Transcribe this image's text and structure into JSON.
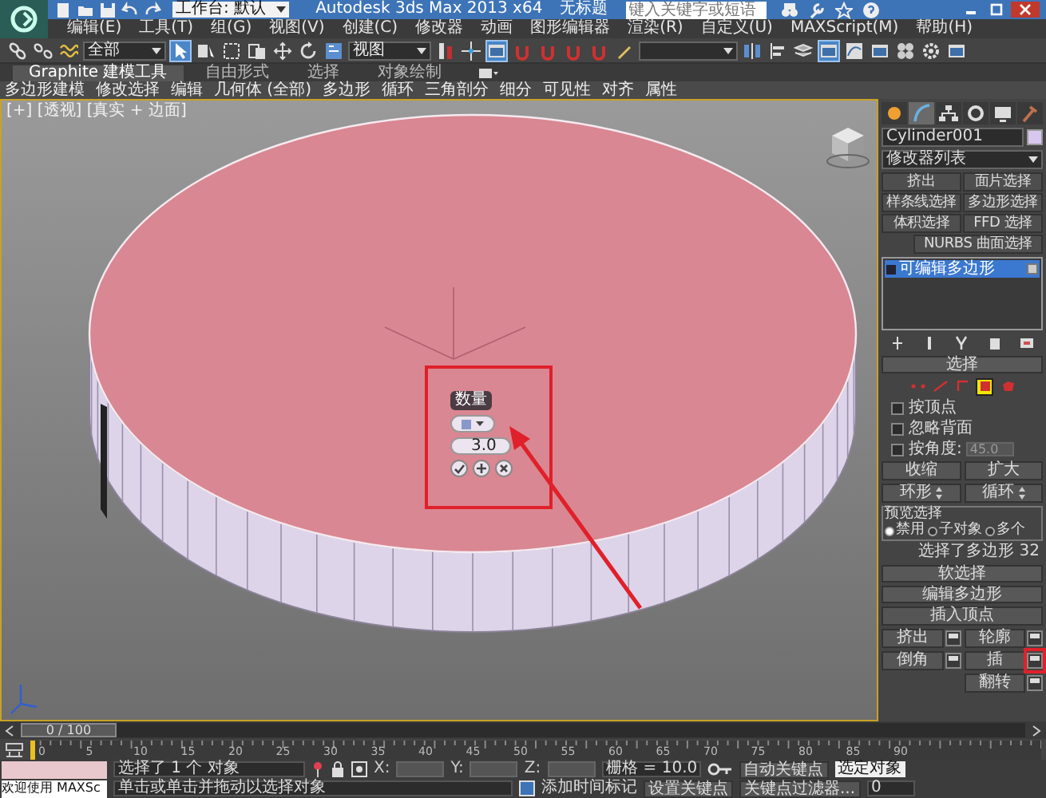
{
  "title_bar": {
    "workspace": "工作台: 默认",
    "app_title": "Autodesk 3ds Max  2013 x64",
    "document": "无标题",
    "search_placeholder": "键入关键字或短语"
  },
  "menu_bar": [
    "编辑(E)",
    "工具(T)",
    "组(G)",
    "视图(V)",
    "创建(C)",
    "修改器",
    "动画",
    "图形编辑器",
    "渲染(R)",
    "自定义(U)",
    "MAXScript(M)",
    "帮助(H)"
  ],
  "main_toolbar": {
    "selection_filter": "全部",
    "reference_coordinate": "视图",
    "tools": [
      {
        "selected": false
      },
      {
        "selected": false
      },
      {
        "selected": false
      },
      {
        "selected": true
      },
      {
        "selected": false
      },
      {
        "selected": false
      },
      {
        "selected": false
      },
      {
        "selected": false
      },
      {
        "selected": false
      },
      {
        "selected": false
      },
      {
        "selected": false
      },
      {
        "selected": false
      },
      {
        "selected": true
      },
      {
        "selected": false
      },
      {
        "selected": false
      },
      {
        "selected": false
      },
      {
        "selected": false
      },
      {
        "selected": false
      },
      {
        "selected": false
      },
      {
        "selected": false
      },
      {
        "selected": false
      },
      {
        "selected": true
      },
      {
        "selected": false
      },
      {
        "selected": false
      },
      {
        "selected": false
      },
      {
        "selected": false
      },
      {
        "selected": false
      }
    ]
  },
  "ribbon": {
    "tabs": [
      {
        "label": "Graphite 建模工具",
        "selected": true
      },
      {
        "label": "自由形式",
        "selected": false
      },
      {
        "label": "选择",
        "selected": false
      },
      {
        "label": "对象绘制",
        "selected": false
      }
    ],
    "panels": [
      "多边形建模",
      "修改选择",
      "编辑",
      "几何体 (全部)",
      "多边形",
      "循环",
      "三角剖分",
      "细分",
      "可见性",
      "对齐",
      "属性"
    ]
  },
  "viewport": {
    "label": "[+] [透视] [真实 + 边面]",
    "caddy": {
      "label": "数量",
      "value": "3.0"
    }
  },
  "command_panel": {
    "tabs": [
      {
        "selected": false
      },
      {
        "selected": true
      },
      {
        "selected": false
      },
      {
        "selected": false
      },
      {
        "selected": false
      },
      {
        "selected": false
      }
    ],
    "object_name": "Cylinder001",
    "modifier_list": "修改器列表",
    "modifier_buttons": [
      "挤出",
      "面片选择",
      "样条线选择",
      "多边形选择",
      "体积选择",
      "FFD 选择",
      "NURBS 曲面选择"
    ],
    "stack": [
      {
        "label": "可编辑多边形",
        "selected": true
      }
    ],
    "selection": {
      "title": "选择",
      "subobject_levels": [
        {
          "selected": false
        },
        {
          "selected": false
        },
        {
          "selected": false
        },
        {
          "selected": true
        },
        {
          "selected": false
        }
      ],
      "checkboxes": [
        {
          "label": "按顶点",
          "checked": false
        },
        {
          "label": "忽略背面",
          "checked": false
        },
        {
          "label": "按角度:",
          "checked": false
        }
      ],
      "angle": "45.0",
      "buttons": [
        "收缩",
        "扩大"
      ],
      "spinner_buttons": [
        "环形",
        "循环"
      ],
      "preview_label": "预览选择",
      "preview_options": [
        {
          "label": "禁用",
          "selected": true
        },
        {
          "label": "子对象",
          "selected": false
        },
        {
          "label": "多个",
          "selected": false
        }
      ],
      "status": "选择了多边形 32"
    },
    "soft_selection": "软选择",
    "edit_polygons": {
      "title": "编辑多边形",
      "insert_vertex": "插入顶点",
      "operations": [
        "挤出",
        "轮廓",
        "倒角",
        "插",
        "翻转"
      ]
    }
  },
  "timeline": {
    "position": "0 / 100",
    "ticks": [
      "0",
      "5",
      "10",
      "15",
      "20",
      "25",
      "30",
      "35",
      "40",
      "45",
      "50",
      "55",
      "60",
      "65",
      "70",
      "75",
      "80",
      "85",
      "90"
    ]
  },
  "status_bar": {
    "maxscript": "欢迎使用 MAXSc",
    "selection": "选择了 1 个 对象",
    "prompt": "单击或单击并拖动以选择对象",
    "coords": [
      "X:",
      "Y:",
      "Z:"
    ],
    "grid": "栅格 = 10.0",
    "time_tag": "添加时间标记",
    "auto_key": "自动关键点",
    "key_mode": "选定对象",
    "set_key": "设置关键点",
    "key_filters": "关键点过滤器...",
    "frame": "0"
  }
}
